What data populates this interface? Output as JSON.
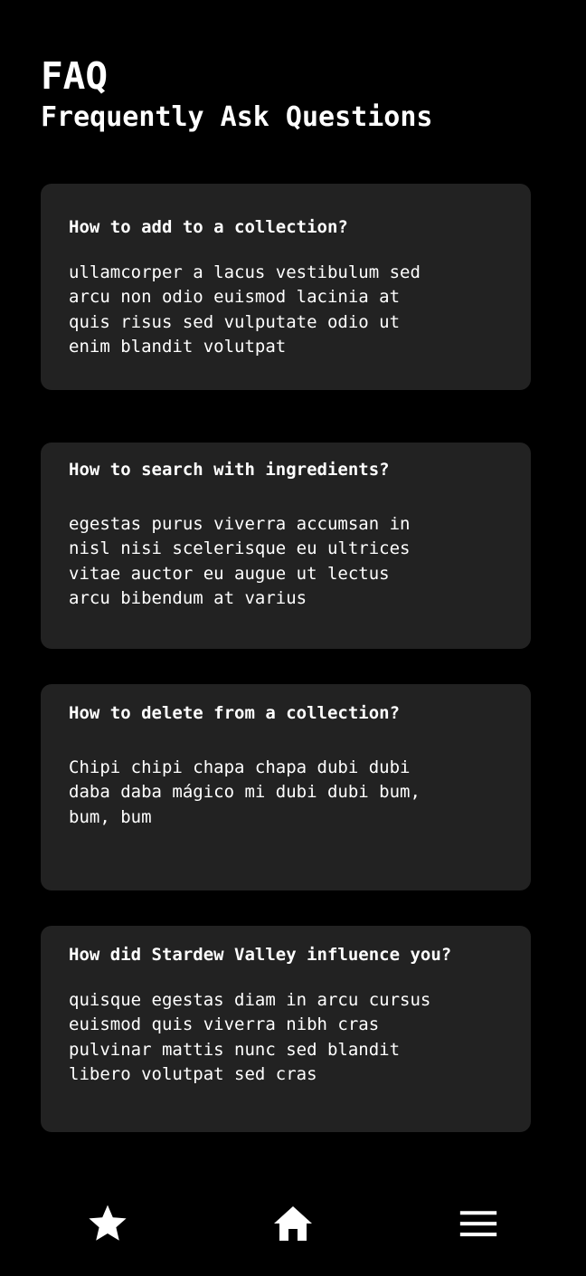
{
  "header": {
    "title": "FAQ",
    "subtitle": "Frequently Ask Questions"
  },
  "faq": [
    {
      "question": "How to add to a collection?",
      "answer": "ullamcorper a lacus vestibulum sed\narcu non odio euismod lacinia at\nquis risus sed vulputate odio ut\nenim blandit volutpat"
    },
    {
      "question": "How to search with ingredients?",
      "answer": "egestas purus viverra accumsan in\nnisl nisi scelerisque eu ultrices\nvitae auctor eu augue ut lectus\narcu bibendum at varius"
    },
    {
      "question": "How to delete from a collection?",
      "answer": "Chipi chipi chapa chapa dubi dubi\ndaba daba mágico mi dubi dubi bum,\nbum, bum"
    },
    {
      "question": "How did Stardew Valley influence you?",
      "answer": "quisque egestas diam in arcu cursus\neuismod quis viverra nibh cras\npulvinar mattis nunc sed blandit\nlibero volutpat sed cras"
    }
  ],
  "nav": {
    "items": [
      {
        "icon": "star-icon"
      },
      {
        "icon": "home-icon"
      },
      {
        "icon": "menu-icon"
      }
    ]
  },
  "colors": {
    "background": "#000000",
    "card": "#222222",
    "text": "#ffffff"
  }
}
